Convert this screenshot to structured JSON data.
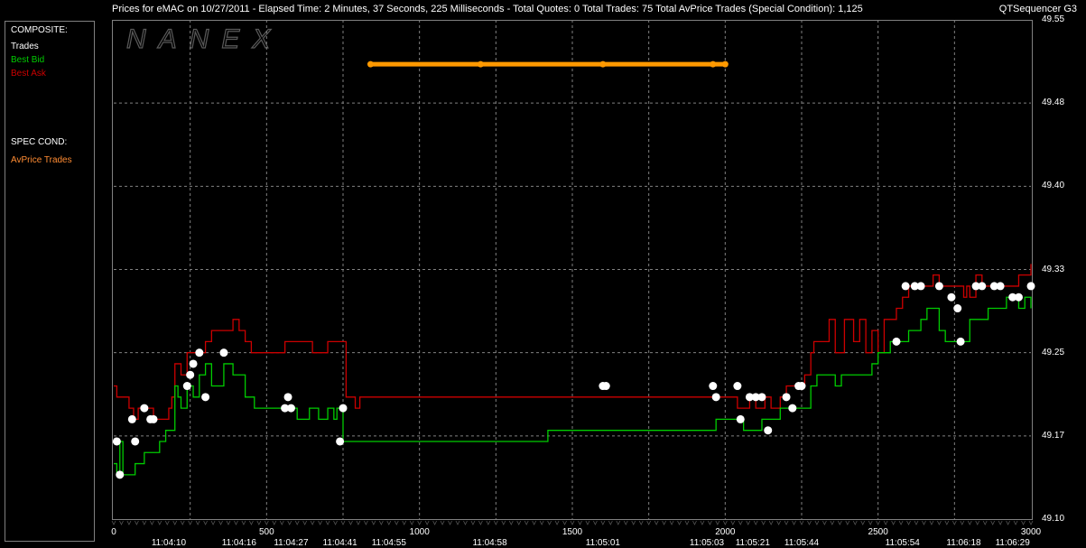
{
  "header": {
    "title": "Prices for  eMAC  on  10/27/2011  -  Elapsed Time: 2 Minutes, 37 Seconds, 225 Milliseconds  -  Total Quotes: 0  Total Trades: 75  Total AvPrice Trades (Special Condition): 1,125",
    "app_name": "QTSequencer G3"
  },
  "legend": {
    "composite_label": "COMPOSITE:",
    "trades_label": "Trades",
    "best_bid_label": "Best Bid",
    "best_ask_label": "Best Ask",
    "spec_cond_label": "SPEC COND:",
    "avprice_label": "AvPrice Trades"
  },
  "watermark": "NANEX",
  "colors": {
    "background": "#000000",
    "grid": "#808080",
    "trades": "#ffffff",
    "best_bid": "#00cc00",
    "best_ask": "#cc0000",
    "avprice": "#ff9900",
    "spec_text": "#ff8c33"
  },
  "chart_data": {
    "type": "line",
    "x_axis": {
      "range": [
        0,
        3000
      ],
      "ticks": [
        0,
        500,
        1000,
        1500,
        2000,
        2500,
        3000
      ]
    },
    "y_axis": {
      "range": [
        49.1,
        49.55
      ],
      "ticks": [
        "49.55",
        "49.48",
        "49.40",
        "49.33",
        "49.25",
        "49.17",
        "49.10"
      ],
      "tick_values": [
        49.55,
        49.475,
        49.4,
        49.325,
        49.25,
        49.175,
        49.1
      ],
      "side": "right"
    },
    "time_labels": [
      {
        "x": 180,
        "label": "11:04:10"
      },
      {
        "x": 410,
        "label": "11:04:16"
      },
      {
        "x": 580,
        "label": "11:04:27"
      },
      {
        "x": 740,
        "label": "11:04:41"
      },
      {
        "x": 900,
        "label": "11:04:55"
      },
      {
        "x": 1230,
        "label": "11:04:58"
      },
      {
        "x": 1600,
        "label": "11:05:01"
      },
      {
        "x": 1940,
        "label": "11:05:03"
      },
      {
        "x": 2090,
        "label": "11:05:21"
      },
      {
        "x": 2250,
        "label": "11:05:44"
      },
      {
        "x": 2580,
        "label": "11:05:54"
      },
      {
        "x": 2780,
        "label": "11:06:18"
      },
      {
        "x": 2940,
        "label": "11:06:29"
      }
    ],
    "grid": true,
    "series": [
      {
        "name": "Best Ask",
        "step": true,
        "points": [
          [
            0,
            49.22
          ],
          [
            10,
            49.21
          ],
          [
            50,
            49.2
          ],
          [
            65,
            49.19
          ],
          [
            80,
            49.2
          ],
          [
            100,
            49.2
          ],
          [
            130,
            49.19
          ],
          [
            150,
            49.19
          ],
          [
            180,
            49.2
          ],
          [
            190,
            49.21
          ],
          [
            200,
            49.24
          ],
          [
            220,
            49.23
          ],
          [
            240,
            49.25
          ],
          [
            260,
            49.25
          ],
          [
            300,
            49.26
          ],
          [
            320,
            49.27
          ],
          [
            380,
            49.27
          ],
          [
            390,
            49.28
          ],
          [
            400,
            49.28
          ],
          [
            410,
            49.27
          ],
          [
            430,
            49.26
          ],
          [
            450,
            49.25
          ],
          [
            550,
            49.25
          ],
          [
            560,
            49.26
          ],
          [
            640,
            49.26
          ],
          [
            650,
            49.25
          ],
          [
            690,
            49.25
          ],
          [
            700,
            49.26
          ],
          [
            740,
            49.26
          ],
          [
            760,
            49.21
          ],
          [
            780,
            49.21
          ],
          [
            790,
            49.2
          ],
          [
            805,
            49.21
          ],
          [
            1600,
            49.21
          ],
          [
            1990,
            49.21
          ],
          [
            2010,
            49.21
          ],
          [
            2020,
            49.21
          ],
          [
            2040,
            49.2
          ],
          [
            2060,
            49.2
          ],
          [
            2080,
            49.21
          ],
          [
            2100,
            49.2
          ],
          [
            2130,
            49.21
          ],
          [
            2150,
            49.2
          ],
          [
            2180,
            49.21
          ],
          [
            2200,
            49.22
          ],
          [
            2240,
            49.22
          ],
          [
            2260,
            49.23
          ],
          [
            2280,
            49.25
          ],
          [
            2290,
            49.26
          ],
          [
            2330,
            49.26
          ],
          [
            2340,
            49.28
          ],
          [
            2360,
            49.25
          ],
          [
            2390,
            49.28
          ],
          [
            2420,
            49.26
          ],
          [
            2440,
            49.28
          ],
          [
            2460,
            49.25
          ],
          [
            2480,
            49.27
          ],
          [
            2500,
            49.25
          ],
          [
            2520,
            49.28
          ],
          [
            2540,
            49.28
          ],
          [
            2560,
            49.29
          ],
          [
            2580,
            49.3
          ],
          [
            2600,
            49.31
          ],
          [
            2640,
            49.31
          ],
          [
            2680,
            49.32
          ],
          [
            2700,
            49.31
          ],
          [
            2780,
            49.3
          ],
          [
            2790,
            49.31
          ],
          [
            2800,
            49.3
          ],
          [
            2820,
            49.32
          ],
          [
            2840,
            49.31
          ],
          [
            2900,
            49.31
          ],
          [
            2940,
            49.31
          ],
          [
            2960,
            49.32
          ],
          [
            3000,
            49.32
          ],
          [
            3040,
            49.33
          ],
          [
            3100,
            49.33
          ]
        ]
      },
      {
        "name": "Best Bid",
        "step": true,
        "points": [
          [
            0,
            49.15
          ],
          [
            10,
            49.14
          ],
          [
            20,
            49.17
          ],
          [
            30,
            49.14
          ],
          [
            60,
            49.14
          ],
          [
            70,
            49.15
          ],
          [
            100,
            49.16
          ],
          [
            150,
            49.17
          ],
          [
            170,
            49.18
          ],
          [
            200,
            49.22
          ],
          [
            210,
            49.21
          ],
          [
            220,
            49.2
          ],
          [
            240,
            49.22
          ],
          [
            260,
            49.21
          ],
          [
            280,
            49.23
          ],
          [
            300,
            49.24
          ],
          [
            320,
            49.22
          ],
          [
            360,
            49.24
          ],
          [
            380,
            49.24
          ],
          [
            390,
            49.23
          ],
          [
            410,
            49.23
          ],
          [
            430,
            49.21
          ],
          [
            450,
            49.21
          ],
          [
            460,
            49.2
          ],
          [
            560,
            49.2
          ],
          [
            600,
            49.19
          ],
          [
            640,
            49.2
          ],
          [
            660,
            49.2
          ],
          [
            670,
            49.19
          ],
          [
            700,
            49.2
          ],
          [
            720,
            49.19
          ],
          [
            730,
            49.2
          ],
          [
            740,
            49.2
          ],
          [
            750,
            49.17
          ],
          [
            1400,
            49.17
          ],
          [
            1420,
            49.18
          ],
          [
            1600,
            49.18
          ],
          [
            1960,
            49.18
          ],
          [
            1970,
            49.19
          ],
          [
            2000,
            49.19
          ],
          [
            2040,
            49.19
          ],
          [
            2060,
            49.18
          ],
          [
            2100,
            49.18
          ],
          [
            2120,
            49.19
          ],
          [
            2160,
            49.19
          ],
          [
            2180,
            49.2
          ],
          [
            2260,
            49.2
          ],
          [
            2280,
            49.22
          ],
          [
            2300,
            49.23
          ],
          [
            2360,
            49.22
          ],
          [
            2380,
            49.23
          ],
          [
            2460,
            49.23
          ],
          [
            2480,
            49.24
          ],
          [
            2500,
            49.25
          ],
          [
            2530,
            49.25
          ],
          [
            2540,
            49.26
          ],
          [
            2560,
            49.26
          ],
          [
            2600,
            49.27
          ],
          [
            2640,
            49.28
          ],
          [
            2660,
            49.29
          ],
          [
            2700,
            49.27
          ],
          [
            2720,
            49.26
          ],
          [
            2780,
            49.26
          ],
          [
            2800,
            49.28
          ],
          [
            2860,
            49.29
          ],
          [
            2920,
            49.3
          ],
          [
            2960,
            49.29
          ],
          [
            2980,
            49.3
          ],
          [
            3000,
            49.29
          ],
          [
            3040,
            49.3
          ],
          [
            3100,
            49.3
          ]
        ]
      },
      {
        "name": "Trades",
        "points": [
          [
            10,
            49.17
          ],
          [
            20,
            49.14
          ],
          [
            60,
            49.19
          ],
          [
            70,
            49.17
          ],
          [
            100,
            49.2
          ],
          [
            120,
            49.19
          ],
          [
            130,
            49.19
          ],
          [
            240,
            49.22
          ],
          [
            250,
            49.23
          ],
          [
            260,
            49.24
          ],
          [
            280,
            49.25
          ],
          [
            300,
            49.21
          ],
          [
            360,
            49.25
          ],
          [
            560,
            49.2
          ],
          [
            570,
            49.21
          ],
          [
            580,
            49.2
          ],
          [
            740,
            49.17
          ],
          [
            750,
            49.2
          ],
          [
            1600,
            49.22
          ],
          [
            1610,
            49.22
          ],
          [
            1960,
            49.22
          ],
          [
            1970,
            49.21
          ],
          [
            2040,
            49.22
          ],
          [
            2050,
            49.19
          ],
          [
            2080,
            49.21
          ],
          [
            2100,
            49.21
          ],
          [
            2120,
            49.21
          ],
          [
            2140,
            49.18
          ],
          [
            2200,
            49.21
          ],
          [
            2220,
            49.2
          ],
          [
            2240,
            49.22
          ],
          [
            2250,
            49.22
          ],
          [
            2560,
            49.26
          ],
          [
            2590,
            49.31
          ],
          [
            2620,
            49.31
          ],
          [
            2640,
            49.31
          ],
          [
            2700,
            49.31
          ],
          [
            2740,
            49.3
          ],
          [
            2760,
            49.29
          ],
          [
            2770,
            49.26
          ],
          [
            2820,
            49.31
          ],
          [
            2840,
            49.31
          ],
          [
            2880,
            49.31
          ],
          [
            2900,
            49.31
          ],
          [
            2940,
            49.3
          ],
          [
            2960,
            49.3
          ],
          [
            3000,
            49.31
          ]
        ]
      },
      {
        "name": "AvPrice Trades",
        "points": [
          [
            840,
            49.51
          ],
          [
            1200,
            49.51
          ],
          [
            1600,
            49.51
          ],
          [
            1960,
            49.51
          ],
          [
            2000,
            49.51
          ]
        ]
      }
    ],
    "legend": "left-panel"
  }
}
